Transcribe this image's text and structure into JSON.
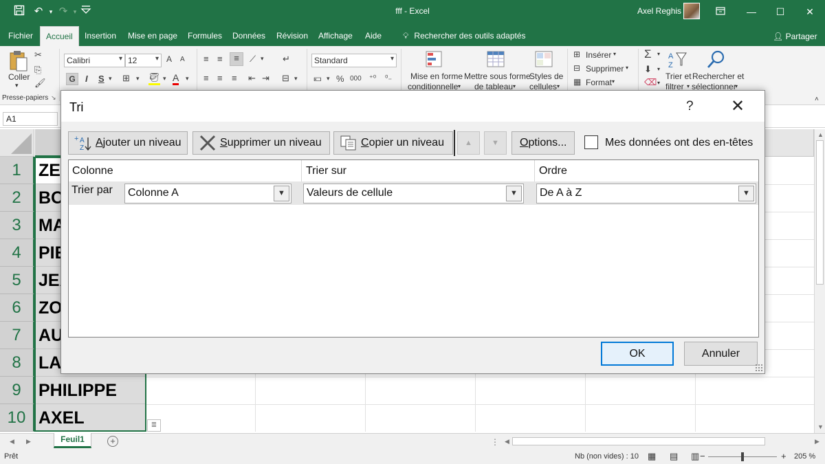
{
  "window": {
    "title": "fff  -  Excel",
    "user": "Axel Reghis",
    "icons": [
      "save-icon",
      "undo-icon",
      "redo-icon",
      "customize-qat-icon",
      "ribbon-display-icon",
      "minimize-icon",
      "maximize-icon",
      "close-icon"
    ]
  },
  "tabs": [
    "Fichier",
    "Accueil",
    "Insertion",
    "Mise en page",
    "Formules",
    "Données",
    "Révision",
    "Affichage",
    "Aide"
  ],
  "tell_me": "Rechercher des outils adaptés",
  "share": "Partager",
  "ribbon": {
    "coller": "Coller",
    "presse_papiers": "Presse-papiers",
    "font_name": "Calibri",
    "font_size": "12",
    "bold": "G",
    "italic": "I",
    "underline": "S",
    "grow": "A",
    "shrink": "A",
    "font_color": "A",
    "number_format": "Standard",
    "percent": "%",
    "thousands": "000",
    "mise_en_forme_1": "Mise en forme",
    "mise_en_forme_2": "conditionnelle",
    "tableau_1": "Mettre sous forme",
    "tableau_2": "de tableau",
    "styles_1": "Styles de",
    "styles_2": "cellules",
    "inserer": "Insérer",
    "supprimer": "Supprimer",
    "format": "Format",
    "sigma": "Σ",
    "trier_1": "Trier et",
    "trier_2": "filtrer",
    "rechercher_1": "Rechercher et",
    "rechercher_2": "sélectionner"
  },
  "formula_bar": {
    "name_box": "A1"
  },
  "sheet": {
    "rows": [
      {
        "num": "1",
        "value": "ZE"
      },
      {
        "num": "2",
        "value": "BO"
      },
      {
        "num": "3",
        "value": "MA"
      },
      {
        "num": "4",
        "value": "PIE"
      },
      {
        "num": "5",
        "value": "JEA"
      },
      {
        "num": "6",
        "value": "ZO"
      },
      {
        "num": "7",
        "value": "AU"
      },
      {
        "num": "8",
        "value": "LA"
      },
      {
        "num": "9",
        "value": "PHILIPPE"
      },
      {
        "num": "10",
        "value": "AXEL"
      }
    ],
    "tab": "Feuil1"
  },
  "status": {
    "ready": "Prêt",
    "count": "Nb (non vides) : 10",
    "zoom_minus": "−",
    "zoom_plus": "+",
    "zoom": "205 %"
  },
  "dialog": {
    "title": "Tri",
    "help": "?",
    "close": "✕",
    "add_level": "Ajouter un niveau",
    "delete_level": "Supprimer un niveau",
    "copy_level": "Copier un niveau",
    "options": "Options...",
    "headers_checkbox": "Mes données ont des en-têtes",
    "headers_checked": false,
    "col_colonne": "Colonne",
    "col_trier_sur": "Trier sur",
    "col_ordre": "Ordre",
    "row_label": "Trier par",
    "column_value": "Colonne A",
    "sort_on_value": "Valeurs de cellule",
    "order_value": "De A à Z",
    "ok": "OK",
    "cancel": "Annuler"
  },
  "colors": {
    "brand": "#217346",
    "dialog_bg": "#f0f0f0",
    "ok_border": "#0078d7"
  }
}
